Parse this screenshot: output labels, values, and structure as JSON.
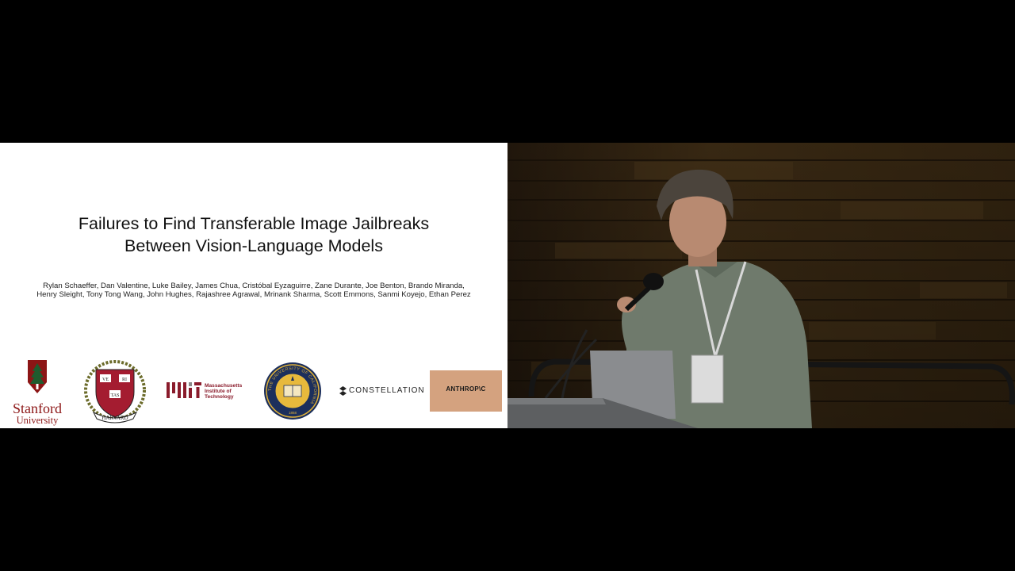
{
  "slide": {
    "title_lines": [
      "Failures to Find Transferable Image Jailbreaks",
      "Between Vision-Language Models"
    ],
    "author_lines": [
      "Rylan Schaeffer, Dan Valentine, Luke Bailey, James Chua, Cristóbal Eyzaguirre, Zane Durante, Joe Benton, Brando Miranda,",
      "Henry Sleight, Tony Tong Wang, John Hughes, Rajashree Agrawal, Mrinank Sharma, Scott Emmons, Sanmi Koyejo, Ethan Perez"
    ],
    "logos": {
      "stanford": {
        "line1": "Stanford",
        "line2": "University",
        "color": "#8c1515"
      },
      "harvard": {
        "shield_letters": [
          "VE",
          "RI",
          "TAS"
        ],
        "ribbon": "HARVARD",
        "color": "#a41c30"
      },
      "mit": {
        "lines": [
          "Massachusetts",
          "Institute of",
          "Technology"
        ],
        "color": "#8a1b2b"
      },
      "uc": {
        "ring_text": "THE UNIVERSITY OF CALIFORNIA",
        "year": "1868",
        "color": "#1c2f5c"
      },
      "constellation": {
        "label": "CONSTELLATION"
      },
      "anthropic": {
        "label": "ANTHROP\\C",
        "color": "#d4a27f"
      }
    }
  },
  "video": {
    "description_icon": "speaker-camera-feed"
  }
}
